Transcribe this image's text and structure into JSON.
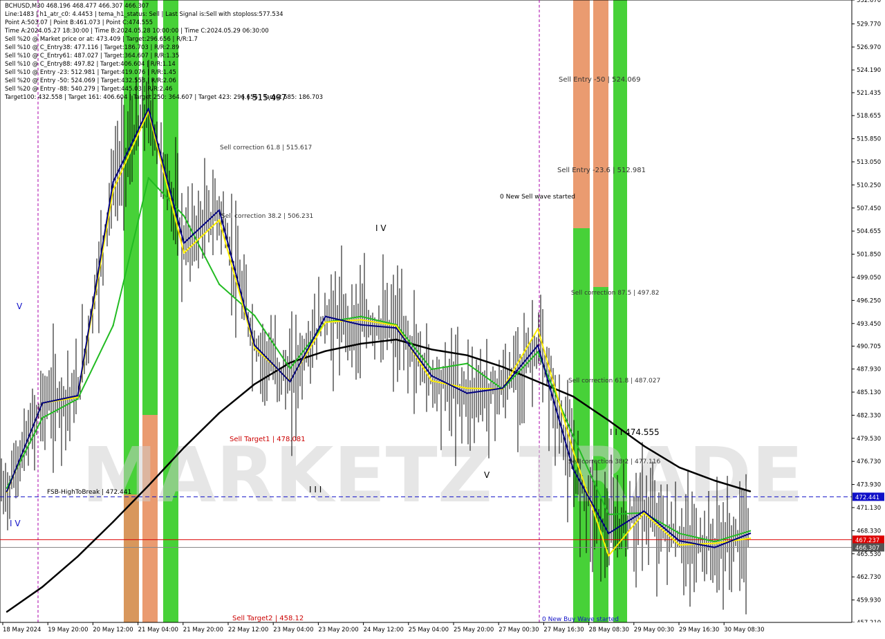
{
  "header": {
    "symbol_line": "BCHUSD,M30  468.196 468.477 466.307 466.307",
    "info_lines": [
      "Line:1483  |  h1_atr_c0: 4.4453  |  tema_h1_status: Sell  |  Last Signal is:Sell with stoploss:577.534",
      "Point A:503.07  |  Point B:461.073  |  Point C:474.555",
      "Time A:2024.05.27 18:30:00  |  Time B:2024.05.28 10:00:00  |  Time C:2024.05.29 06:30:00",
      "Sell %20 @ Market price or at: 473.409  |  Target:296.656  |  R/R:1.7",
      "Sell %10 @ C_Entry38: 477.116  |  Target:186.703  |  R/R:2.89",
      "Sell %10 @ C_Entry61: 487.027  |  Target:364.607  |  R/R:1.35",
      "Sell %10 @ C_Entry88: 497.82  |  Target:406.604  |  R/R:1.14",
      "Sell %10 @ Entry -23: 512.981  |  Target:419.076  |  R/R:1.45",
      "Sell %20 @ Entry -50: 524.069  |  Target:432.558  |  R/R:2.06",
      "Sell %20 @ Entry -88: 540.279  |  Target:445.03  |  R/R:2.46",
      "Target100: 432.558  |  Target 161: 406.604  |  Target 250: 364.607  |  Target 423: 296.656  |  Target 685: 186.703"
    ]
  },
  "watermark": "MARKETZ TRADE",
  "chart_data": {
    "type": "line",
    "ylim": [
      457.21,
      532.67
    ],
    "y_ticks": [
      "532.670",
      "529.770",
      "526.970",
      "524.190",
      "521.435",
      "518.655",
      "515.850",
      "513.050",
      "510.250",
      "507.450",
      "504.655",
      "501.850",
      "499.050",
      "496.250",
      "493.450",
      "490.705",
      "487.930",
      "485.130",
      "482.330",
      "479.530",
      "476.730",
      "473.930",
      "471.130",
      "468.330",
      "465.530",
      "462.730",
      "459.930",
      "457.210"
    ],
    "x_ticks": [
      "18 May 2024",
      "19 May 20:00",
      "20 May 12:00",
      "21 May 04:00",
      "21 May 20:00",
      "22 May 12:00",
      "23 May 04:00",
      "23 May 20:00",
      "24 May 12:00",
      "25 May 04:00",
      "25 May 20:00",
      "27 May 00:30",
      "27 May 16:30",
      "28 May 08:30",
      "29 May 00:30",
      "29 May 16:30",
      "30 May 08:30"
    ],
    "price_labels": [
      {
        "text": "472.441",
        "value": 472.441,
        "color": "#1010c8"
      },
      {
        "text": "467.237",
        "value": 467.237,
        "color": "#dd0000"
      },
      {
        "text": "466.307",
        "value": 466.307,
        "color": "#555555"
      }
    ],
    "horizontal_lines": [
      {
        "value": 472.441,
        "color": "#1010c8",
        "style": "dashed"
      },
      {
        "value": 467.237,
        "color": "#dd0000",
        "style": "solid"
      },
      {
        "value": 466.307,
        "color": "#888888",
        "style": "solid"
      }
    ],
    "annotations": [
      {
        "text": "Sell Entry -50 | 524.069",
        "color": "#333333"
      },
      {
        "text": "Sell Entry -23.6 | 512.981",
        "color": "#333333"
      },
      {
        "text": "0 New Sell wave started",
        "color": "#000000"
      },
      {
        "text": "Sell correction 87.5 | 497.82",
        "color": "#333333"
      },
      {
        "text": "Sell correction 61.8 | 487.027",
        "color": "#333333"
      },
      {
        "text": "I I I 474.555",
        "color": "#000000"
      },
      {
        "text": "Sell correction 38.2 | 477.116",
        "color": "#333333"
      },
      {
        "text": "Sell correction 61.8 | 515.617",
        "color": "#333333"
      },
      {
        "text": "Sell correction 38.2 | 506.231",
        "color": "#333333"
      },
      {
        "text": "I I 515.497",
        "color": "#000000"
      },
      {
        "text": "I V",
        "color": "#000000"
      },
      {
        "text": "V",
        "color": "#000000"
      },
      {
        "text": "I I I",
        "color": "#000000"
      },
      {
        "text": "V",
        "color": "#1010c8"
      },
      {
        "text": "I V",
        "color": "#1010c8"
      },
      {
        "text": "FSB-HighToBreak | 472.441",
        "color": "#000000"
      },
      {
        "text": "Sell Target1 | 478.081",
        "color": "#cc0000"
      },
      {
        "text": "Sell Target2 | 458.12",
        "color": "#cc0000"
      },
      {
        "text": "0 New Buy Wave started",
        "color": "#1010c8"
      }
    ],
    "series": [
      {
        "color": "#000000",
        "values": [
          458.5,
          461.5,
          465.2,
          469.4,
          473.8,
          478.4,
          482.6,
          486.1,
          488.7,
          490.1,
          491.0,
          491.5,
          490.3,
          489.6,
          488.2,
          486.4,
          484.6,
          481.7,
          478.6,
          476.0,
          474.4,
          473.1
        ]
      },
      {
        "color": "#22bb22",
        "values": [
          473.5,
          482.0,
          484.3,
          493.2,
          511.1,
          506.5,
          498.2,
          494.4,
          488.0,
          493.6,
          494.3,
          493.3,
          487.9,
          488.6,
          485.5,
          490.0,
          479.8,
          470.3,
          470.5,
          468.0,
          467.0,
          468.3
        ]
      },
      {
        "color": "#ffee00",
        "values": [
          473.0,
          483.8,
          484.5,
          509.6,
          519.2,
          502.0,
          506.0,
          490.5,
          486.5,
          493.6,
          493.9,
          493.2,
          486.5,
          485.6,
          485.5,
          492.8,
          478.0,
          465.3,
          470.5,
          466.6,
          466.8,
          467.4
        ]
      },
      {
        "color": "#000080",
        "values": [
          473.1,
          483.8,
          484.7,
          510.6,
          519.5,
          503.2,
          507.2,
          490.8,
          486.4,
          494.3,
          493.3,
          492.9,
          487.1,
          485.0,
          485.6,
          490.8,
          475.8,
          468.0,
          470.7,
          467.1,
          466.3,
          468.0
        ]
      }
    ]
  }
}
